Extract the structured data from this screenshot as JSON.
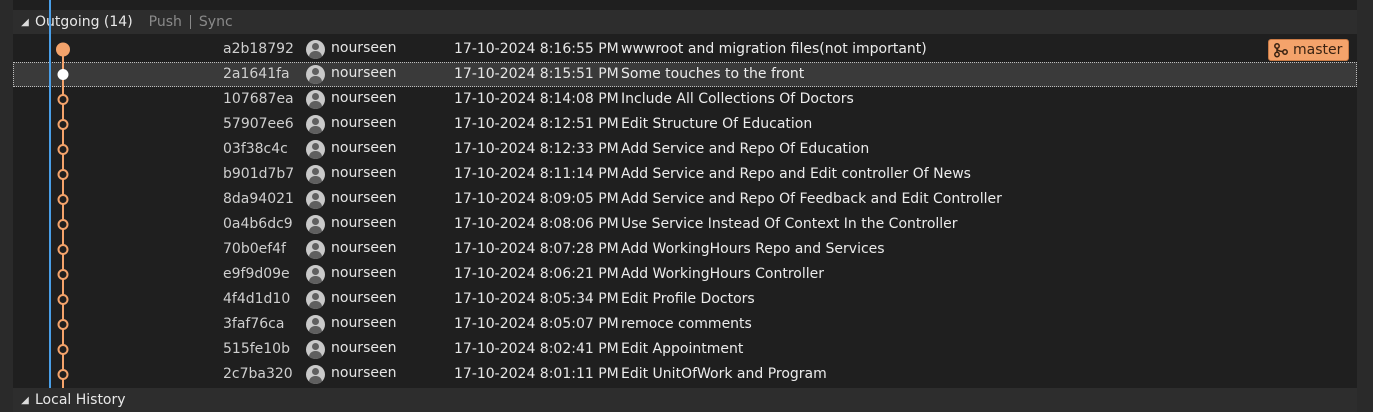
{
  "outgoing": {
    "title": "Outgoing (14)",
    "push_label": "Push",
    "sync_label": "Sync"
  },
  "local_history": {
    "title": "Local History"
  },
  "branch_tag": {
    "label": "master",
    "icon": "branch-icon"
  },
  "commits": [
    {
      "hash": "a2b18792",
      "author": "nourseen",
      "date": "17-10-2024 8:16:55 PM",
      "message": "wwwroot and migration files(not important)"
    },
    {
      "hash": "2a1641fa",
      "author": "nourseen",
      "date": "17-10-2024 8:15:51 PM",
      "message": "Some touches to the front"
    },
    {
      "hash": "107687ea",
      "author": "nourseen",
      "date": "17-10-2024 8:14:08 PM",
      "message": "Include All Collections Of Doctors"
    },
    {
      "hash": "57907ee6",
      "author": "nourseen",
      "date": "17-10-2024 8:12:51 PM",
      "message": "Edit Structure Of Education"
    },
    {
      "hash": "03f38c4c",
      "author": "nourseen",
      "date": "17-10-2024 8:12:33 PM",
      "message": "Add Service and Repo Of Education"
    },
    {
      "hash": "b901d7b7",
      "author": "nourseen",
      "date": "17-10-2024 8:11:14 PM",
      "message": "Add Service and Repo and Edit controller Of News"
    },
    {
      "hash": "8da94021",
      "author": "nourseen",
      "date": "17-10-2024 8:09:05 PM",
      "message": "Add Service and Repo Of Feedback and Edit Controller"
    },
    {
      "hash": "0a4b6dc9",
      "author": "nourseen",
      "date": "17-10-2024 8:08:06 PM",
      "message": "Use Service Instead Of Context In the Controller"
    },
    {
      "hash": "70b0ef4f",
      "author": "nourseen",
      "date": "17-10-2024 8:07:28 PM",
      "message": "Add WorkingHours Repo and Services"
    },
    {
      "hash": "e9f9d09e",
      "author": "nourseen",
      "date": "17-10-2024 8:06:21 PM",
      "message": "Add WorkingHours Controller"
    },
    {
      "hash": "4f4d1d10",
      "author": "nourseen",
      "date": "17-10-2024 8:05:34 PM",
      "message": "Edit Profile Doctors"
    },
    {
      "hash": "3faf76ca",
      "author": "nourseen",
      "date": "17-10-2024 8:05:07 PM",
      "message": "remoce comments"
    },
    {
      "hash": "515fe10b",
      "author": "nourseen",
      "date": "17-10-2024 8:02:41 PM",
      "message": "Edit Appointment"
    },
    {
      "hash": "2c7ba320",
      "author": "nourseen",
      "date": "17-10-2024 8:01:11 PM",
      "message": "Edit UnitOfWork and Program"
    }
  ],
  "colors": {
    "graph_blue": "#4a9fe8",
    "graph_orange": "#f4a36b",
    "selected_node": "#ffffff"
  }
}
